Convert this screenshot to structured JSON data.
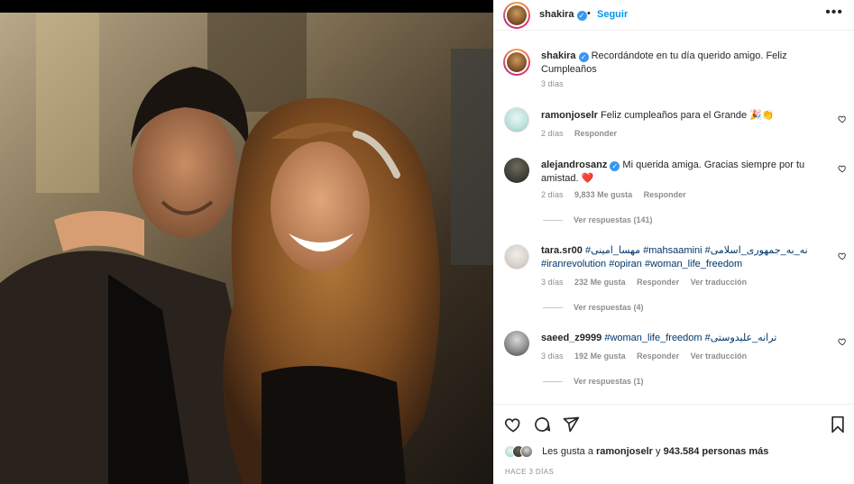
{
  "post": {
    "photo_alt": "",
    "author": "shakira",
    "follow_label": "Seguir",
    "separator": "•",
    "more_label": "•••"
  },
  "caption": {
    "username": "shakira",
    "text": "Recordándote en tu día querido amigo. Feliz Cumpleaños",
    "time": "3 días"
  },
  "comments": [
    {
      "username": "ramonjoselr",
      "text": "Feliz cumpleaños para el Grande 🎉👏",
      "time": "2 días",
      "reply_label": "Responder"
    },
    {
      "username": "alejandrosanz",
      "verified": true,
      "text": "Mi querida amiga. Gracias siempre por tu amistad. ❤️",
      "time": "2 días",
      "likes": "9,833 Me gusta",
      "reply_label": "Responder",
      "replies_label": "Ver respuestas (141)"
    },
    {
      "username": "tara.sr00",
      "text_before": " ",
      "tags": [
        "#مهسا_امینی",
        "#mahsaamini",
        "#نه_به_جمهوری_اسلامی",
        "#iranrevolution",
        "#opiran",
        "#woman_life_freedom"
      ],
      "time": "3 días",
      "likes": "232 Me gusta",
      "reply_label": "Responder",
      "translate_label": "Ver traducción",
      "replies_label": "Ver respuestas (4)"
    },
    {
      "username": "saeed_z9999",
      "tags": [
        "#woman_life_freedom",
        "#ترانه_علیدوستی"
      ],
      "time": "3 días",
      "likes": "192 Me gusta",
      "reply_label": "Responder",
      "translate_label": "Ver traducción",
      "replies_label": "Ver respuestas (1)"
    }
  ],
  "likes": {
    "prefix": "Les gusta a",
    "user": "ramonjoselr",
    "middle": "y",
    "count": "943.584 personas más"
  },
  "posted": "HACE 3 DÍAS",
  "icons": {
    "like": "heart-icon",
    "comment": "comment-icon",
    "share": "paper-plane-icon",
    "save": "bookmark-icon",
    "comment_like": "small-heart-icon",
    "verified": "verified-badge-icon"
  },
  "colors": {
    "link_blue": "#0095f6",
    "verified_blue": "#3897f0",
    "hashtag": "#00376b",
    "meta_gray": "#8e8e8e"
  }
}
